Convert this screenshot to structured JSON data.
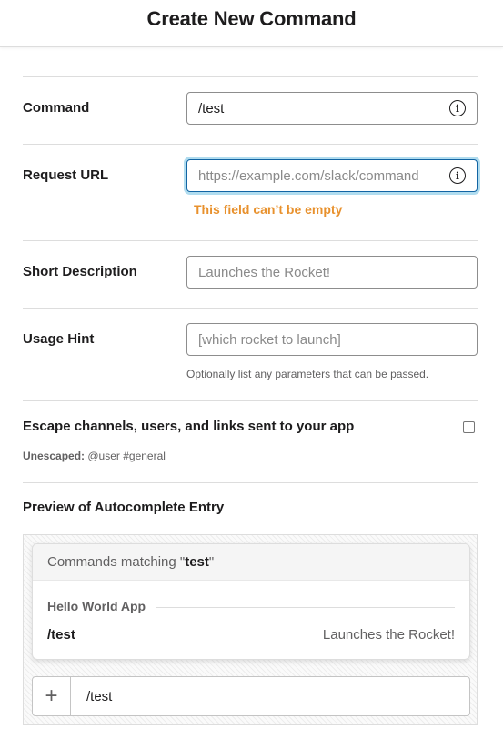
{
  "header": {
    "title": "Create New Command"
  },
  "form": {
    "command": {
      "label": "Command",
      "value": "/test"
    },
    "request_url": {
      "label": "Request URL",
      "placeholder": "https://example.com/slack/command",
      "value": "",
      "error": "This field can’t be empty"
    },
    "short_description": {
      "label": "Short Description",
      "placeholder": "Launches the Rocket!"
    },
    "usage_hint": {
      "label": "Usage Hint",
      "placeholder": "[which rocket to launch]",
      "help": "Optionally list any parameters that can be passed."
    },
    "escape": {
      "label": "Escape channels, users, and links sent to your app",
      "checked": false,
      "unescaped_label": "Unescaped:",
      "unescaped_example": "@user #general"
    }
  },
  "preview": {
    "title": "Preview of Autocomplete Entry",
    "matching_prefix": "Commands matching \"",
    "matching_term": "test",
    "matching_suffix": "\"",
    "app_name": "Hello World App",
    "entry_command": "/test",
    "entry_description": "Launches the Rocket!",
    "composer_plus": "+",
    "composer_text": "/test"
  },
  "icons": {
    "info": "info-circle-icon",
    "plus": "plus-icon"
  },
  "colors": {
    "error": "#e8912d",
    "focus": "#1264a3",
    "text": "#1d1c1d",
    "muted": "#616061"
  }
}
